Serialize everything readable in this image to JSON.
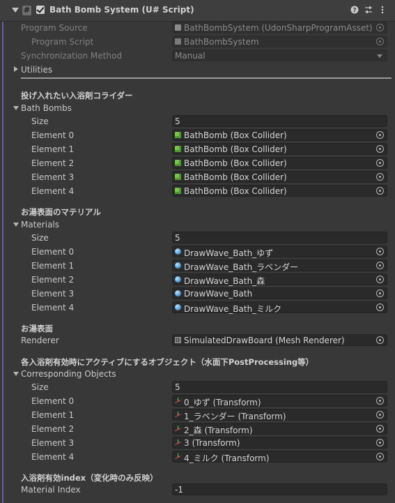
{
  "header": {
    "title": "Bath Bomb System (U# Script)",
    "help_icon": "help-icon",
    "settings_icon": "sliders-icon",
    "menu_icon": "kebab-menu-icon"
  },
  "program": {
    "source_label": "Program Source",
    "source_value": "BathBombSystem (UdonSharpProgramAsset)",
    "script_label": "Program Script",
    "script_value": "BathBombSystem",
    "sync_label": "Synchronization Method",
    "sync_value": "Manual",
    "utilities_label": "Utilities"
  },
  "bath_bombs": {
    "header": "投げ入れたい入浴剤コライダー",
    "list_label": "Bath Bombs",
    "size_label": "Size",
    "size_value": "5",
    "elements": [
      {
        "label": "Element 0",
        "value": "BathBomb (Box Collider)"
      },
      {
        "label": "Element 1",
        "value": "BathBomb (Box Collider)"
      },
      {
        "label": "Element 2",
        "value": "BathBomb (Box Collider)"
      },
      {
        "label": "Element 3",
        "value": "BathBomb (Box Collider)"
      },
      {
        "label": "Element 4",
        "value": "BathBomb (Box Collider)"
      }
    ]
  },
  "materials": {
    "header": "お湯表面のマテリアル",
    "list_label": "Materials",
    "size_label": "Size",
    "size_value": "5",
    "elements": [
      {
        "label": "Element 0",
        "value": "DrawWave_Bath_ゆず"
      },
      {
        "label": "Element 1",
        "value": "DrawWave_Bath_ラベンダー"
      },
      {
        "label": "Element 2",
        "value": "DrawWave_Bath_森"
      },
      {
        "label": "Element 3",
        "value": "DrawWave_Bath"
      },
      {
        "label": "Element 4",
        "value": "DrawWave_Bath_ミルク"
      }
    ]
  },
  "surface": {
    "header": "お湯表面",
    "renderer_label": "Renderer",
    "renderer_value": "SimulatedDrawBoard (Mesh Renderer)"
  },
  "objects": {
    "header": "各入浴剤有効時にアクティブにするオブジェクト（水面下PostProcessing等）",
    "list_label": "Corresponding Objects",
    "size_label": "Size",
    "size_value": "5",
    "elements": [
      {
        "label": "Element 0",
        "value": "0_ゆず (Transform)"
      },
      {
        "label": "Element 1",
        "value": "1_ラベンダー (Transform)"
      },
      {
        "label": "Element 2",
        "value": "2_森 (Transform)"
      },
      {
        "label": "Element 3",
        "value": "3 (Transform)"
      },
      {
        "label": "Element 4",
        "value": "4_ミルク (Transform)"
      }
    ]
  },
  "index": {
    "header": "入浴剤有効index（変化時のみ反映）",
    "label": "Material Index",
    "value": "-1"
  },
  "colors": {
    "background": "#383838",
    "field_background": "#2a2a2a",
    "accent_bar": "#6a5aa8"
  }
}
